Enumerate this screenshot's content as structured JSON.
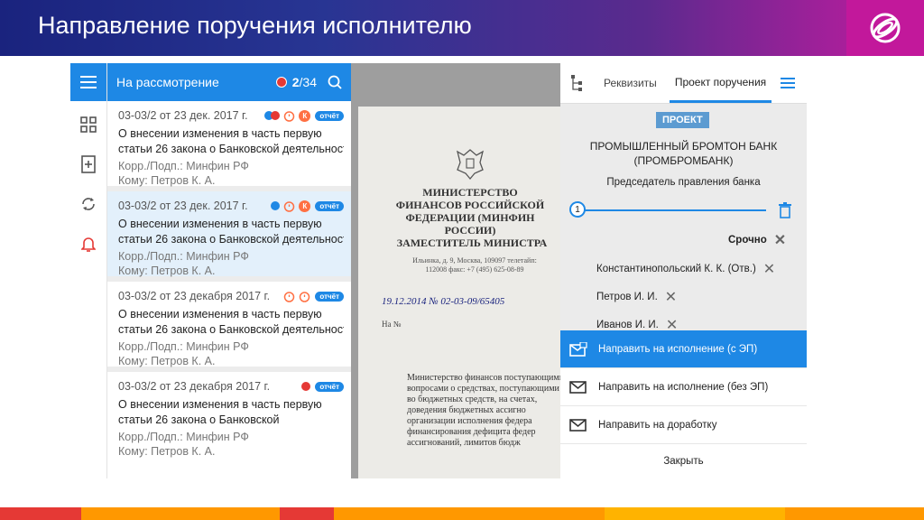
{
  "slide": {
    "title": "Направление поручения исполнителю",
    "colors": {
      "header_start": "#1a237e",
      "header_end": "#c2189b",
      "accent": "#1e88e5"
    },
    "logo_icon": "brand-logo-icon",
    "bottom_strip": [
      "#e53935",
      "#ff9800",
      "#e53935",
      "#ff9800",
      "#ffb300",
      "#ff9800"
    ]
  },
  "rail": {
    "icons": [
      "menu-icon",
      "grid-icon",
      "add-document-icon",
      "sync-icon",
      "bell-icon"
    ]
  },
  "list": {
    "title": "На рассмотрение",
    "count_current": "2",
    "count_total": "/34",
    "items": [
      {
        "number": "03-03/2 от 23 дек. 2017 г.",
        "subject1": "О внесении изменения в часть первую",
        "subject2": "статьи 26 закона о Банковской деятельност...",
        "corr": "Корр./Подп.: Минфин РФ",
        "to": "Кому: Петров К. А.",
        "badge_k": "К",
        "badge_report": "отчёт"
      },
      {
        "number": "03-03/2 от 23 дек. 2017 г.",
        "subject1": "О внесении изменения в часть первую",
        "subject2": "статьи 26 закона о Банковской деятельност...",
        "corr": "Корр./Подп.: Минфин РФ",
        "to": "Кому: Петров К. А.",
        "badge_k": "К",
        "badge_report": "отчёт"
      },
      {
        "number": "03-03/2 от 23 декабря 2017 г.",
        "subject1": "О внесении изменения в часть первую",
        "subject2": "статьи 26 закона о Банковской деятельност...",
        "corr": "Корр./Подп.: Минфин РФ",
        "to": "Кому: Петров К. А.",
        "badge_report": "отчёт"
      },
      {
        "number": "03-03/2 от 23 декабря 2017 г.",
        "subject1": "О внесении изменения в часть первую",
        "subject2": "статьи 26 закона о Банковской",
        "corr": "Корр./Подп.: Минфин РФ",
        "to": "Кому: Петров К. А.",
        "badge_report": "отчёт"
      }
    ]
  },
  "document": {
    "ministry": "МИНИСТЕРСТВО ФИНАНСОВ РОССИЙСКОЙ ФЕДЕРАЦИИ (МИНФИН РОССИИ)",
    "deputy": "ЗАМЕСТИТЕЛЬ МИНИСТРА",
    "address": "Ильинка, д. 9, Москва, 109097 телетайп: 112008 факс: +7 (495) 625-08-89",
    "reg": "19.12.2014 № 02-03-09/65405",
    "na": "На №",
    "body": "Министерство финансов поступающими вопросами о средствах, поступающими во бюджетных средств, на счетах, доведения бюджетных ассигно организации исполнения федера финансирования дефицита федер ассигнований, лимитов бюдж"
  },
  "panel": {
    "tabs": [
      "Реквизиты",
      "Проект поручения"
    ],
    "project_badge": "ПРОЕКТ",
    "bank_line1": "ПРОМЫШЛЕННЫЙ БРОМТОН БАНК",
    "bank_line2": "(ПРОМБРОМБАНК)",
    "chair": "Председатель правления банка",
    "step": "1",
    "urgent": "Срочно",
    "executors": [
      "Константинопольский К. К. (Отв.)",
      "Петров И. И.",
      "Иванов И. И."
    ],
    "actions": [
      "Направить на исполнение (с ЭП)",
      "Направить на исполнение (без ЭП)",
      "Направить на доработку"
    ],
    "close": "Закрыть"
  }
}
